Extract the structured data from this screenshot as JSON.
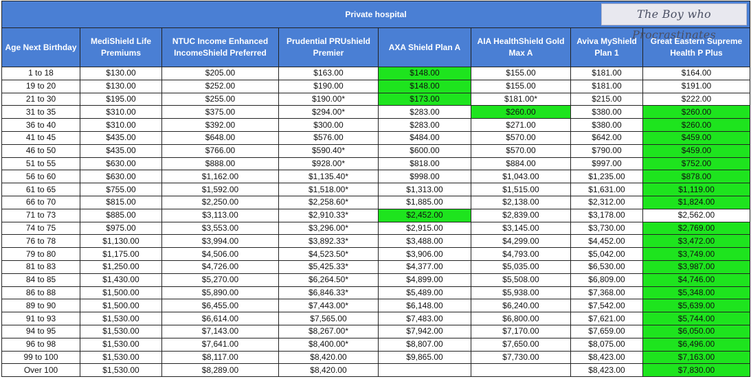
{
  "banner": {
    "title": "Private hospital",
    "logo_text": "The Boy who Procrastinates"
  },
  "columns": [
    "Age Next Birthday",
    "MediShield Life Premiums",
    "NTUC Income Enhanced IncomeShield Preferred",
    "Prudential PRUshield Premier",
    "AXA Shield Plan A",
    "AIA HealthShield Gold Max A",
    "Aviva MyShield Plan 1",
    "Great Eastern Supreme Health P Plus"
  ],
  "highlight_color": "#1ee41e",
  "rows": [
    {
      "cells": [
        "1 to 18",
        "$130.00",
        "$205.00",
        "$163.00",
        "$148.00",
        "$155.00",
        "$181.00",
        "$164.00"
      ],
      "highlight": [
        4
      ]
    },
    {
      "cells": [
        "19 to 20",
        "$130.00",
        "$252.00",
        "$190.00",
        "$148.00",
        "$155.00",
        "$181.00",
        "$191.00"
      ],
      "highlight": [
        4
      ]
    },
    {
      "cells": [
        "21 to 30",
        "$195.00",
        "$255.00",
        "$190.00*",
        "$173.00",
        "$181.00*",
        "$215.00",
        "$222.00"
      ],
      "highlight": [
        4
      ]
    },
    {
      "cells": [
        "31 to 35",
        "$310.00",
        "$375.00",
        "$294.00*",
        "$283.00",
        "$260.00",
        "$380.00",
        "$260.00"
      ],
      "highlight": [
        5,
        7
      ]
    },
    {
      "cells": [
        "36 to 40",
        "$310.00",
        "$392.00",
        "$300.00",
        "$283.00",
        "$271.00",
        "$380.00",
        "$260.00"
      ],
      "highlight": [
        7
      ]
    },
    {
      "cells": [
        "41 to 45",
        "$435.00",
        "$648.00",
        "$576.00",
        "$484.00",
        "$570.00",
        "$642.00",
        "$459.00"
      ],
      "highlight": [
        7
      ]
    },
    {
      "cells": [
        "46 to 50",
        "$435.00",
        "$766.00",
        "$590.40*",
        "$600.00",
        "$570.00",
        "$790.00",
        "$459.00"
      ],
      "highlight": [
        7
      ]
    },
    {
      "cells": [
        "51 to 55",
        "$630.00",
        "$888.00",
        "$928.00*",
        "$818.00",
        "$884.00",
        "$997.00",
        "$752.00"
      ],
      "highlight": [
        7
      ]
    },
    {
      "cells": [
        "56 to 60",
        "$630.00",
        "$1,162.00",
        "$1,135.40*",
        "$998.00",
        "$1,043.00",
        "$1,235.00",
        "$878.00"
      ],
      "highlight": [
        7
      ]
    },
    {
      "cells": [
        "61 to 65",
        "$755.00",
        "$1,592.00",
        "$1,518.00*",
        "$1,313.00",
        "$1,515.00",
        "$1,631.00",
        "$1,119.00"
      ],
      "highlight": [
        7
      ]
    },
    {
      "cells": [
        "66 to 70",
        "$815.00",
        "$2,250.00",
        "$2,258.60*",
        "$1,885.00",
        "$2,138.00",
        "$2,312.00",
        "$1,824.00"
      ],
      "highlight": [
        7
      ]
    },
    {
      "cells": [
        "71 to 73",
        "$885.00",
        "$3,113.00",
        "$2,910.33*",
        "$2,452.00",
        "$2,839.00",
        "$3,178.00",
        "$2,562.00"
      ],
      "highlight": [
        4
      ]
    },
    {
      "cells": [
        "74 to 75",
        "$975.00",
        "$3,553.00",
        "$3,296.00*",
        "$2,915.00",
        "$3,145.00",
        "$3,730.00",
        "$2,769.00"
      ],
      "highlight": [
        7
      ]
    },
    {
      "cells": [
        "76 to 78",
        "$1,130.00",
        "$3,994.00",
        "$3,892.33*",
        "$3,488.00",
        "$4,299.00",
        "$4,452.00",
        "$3,472.00"
      ],
      "highlight": [
        7
      ]
    },
    {
      "cells": [
        "79 to 80",
        "$1,175.00",
        "$4,506.00",
        "$4,523.50*",
        "$3,906.00",
        "$4,793.00",
        "$5,042.00",
        "$3,749.00"
      ],
      "highlight": [
        7
      ]
    },
    {
      "cells": [
        "81 to 83",
        "$1,250.00",
        "$4,726.00",
        "$5,425.33*",
        "$4,377.00",
        "$5,035.00",
        "$6,530.00",
        "$3,987.00"
      ],
      "highlight": [
        7
      ]
    },
    {
      "cells": [
        "84 to 85",
        "$1,430.00",
        "$5,270.00",
        "$6,264.50*",
        "$4,899.00",
        "$5,508.00",
        "$6,809.00",
        "$4,746.00"
      ],
      "highlight": [
        7
      ]
    },
    {
      "cells": [
        "86 to 88",
        "$1,500.00",
        "$5,890.00",
        "$6,846.33*",
        "$5,489.00",
        "$5,938.00",
        "$7,368.00",
        "$5,348.00"
      ],
      "highlight": [
        7
      ]
    },
    {
      "cells": [
        "89 to 90",
        "$1,500.00",
        "$6,455.00",
        "$7,443.00*",
        "$6,148.00",
        "$6,240.00",
        "$7,542.00",
        "$5,639.00"
      ],
      "highlight": [
        7
      ]
    },
    {
      "cells": [
        "91 to 93",
        "$1,530.00",
        "$6,614.00",
        "$7,565.00",
        "$7,483.00",
        "$6,800.00",
        "$7,621.00",
        "$5,744.00"
      ],
      "highlight": [
        7
      ]
    },
    {
      "cells": [
        "94 to 95",
        "$1,530.00",
        "$7,143.00",
        "$8,267.00*",
        "$7,942.00",
        "$7,170.00",
        "$7,659.00",
        "$6,050.00"
      ],
      "highlight": [
        7
      ]
    },
    {
      "cells": [
        "96 to 98",
        "$1,530.00",
        "$7,641.00",
        "$8,400.00*",
        "$8,807.00",
        "$7,650.00",
        "$8,075.00",
        "$6,496.00"
      ],
      "highlight": [
        7
      ]
    },
    {
      "cells": [
        "99 to 100",
        "$1,530.00",
        "$8,117.00",
        "$8,420.00",
        "$9,865.00",
        "$7,730.00",
        "$8,423.00",
        "$7,163.00"
      ],
      "highlight": [
        7
      ]
    },
    {
      "cells": [
        "Over 100",
        "$1,530.00",
        "$8,289.00",
        "$8,420.00",
        "",
        "",
        "$8,423.00",
        "$7,830.00"
      ],
      "highlight": [
        7
      ]
    }
  ]
}
